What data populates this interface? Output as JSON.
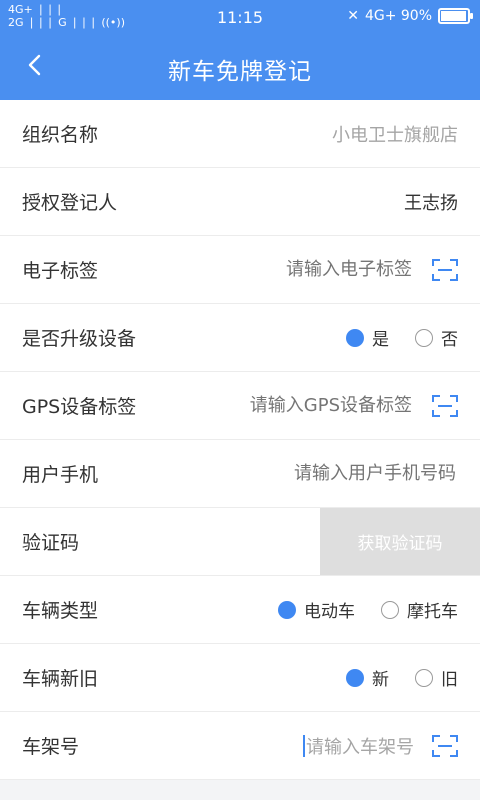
{
  "status": {
    "left_top": "4G+ ❘❘❘",
    "left_bottom": "2G ❘❘❘  G ❘❘❘  ((•))",
    "time": "11:15",
    "right": "4G+ 90%"
  },
  "header": {
    "title": "新车免牌登记",
    "back_icon": "chevron-left-icon"
  },
  "form": {
    "org": {
      "label": "组织名称",
      "value": "小电卫士旗舰店"
    },
    "registrar": {
      "label": "授权登记人",
      "value": "王志扬"
    },
    "etag": {
      "label": "电子标签",
      "placeholder": "请输入电子标签"
    },
    "upgrade": {
      "label": "是否升级设备",
      "options": [
        "是",
        "否"
      ],
      "selected": "是"
    },
    "gps": {
      "label": "GPS设备标签",
      "placeholder": "请输入GPS设备标签"
    },
    "phone": {
      "label": "用户手机",
      "placeholder": "请输入用户手机号码"
    },
    "code": {
      "label": "验证码",
      "button": "获取验证码"
    },
    "vtype": {
      "label": "车辆类型",
      "options": [
        "电动车",
        "摩托车"
      ],
      "selected": "电动车"
    },
    "condition": {
      "label": "车辆新旧",
      "options": [
        "新",
        "旧"
      ],
      "selected": "新"
    },
    "frame": {
      "label": "车架号",
      "placeholder": "请输入车架号"
    }
  },
  "colors": {
    "primary": "#4a8ff0",
    "radio_on": "#3f88f2",
    "button_disabled": "#dedede"
  }
}
